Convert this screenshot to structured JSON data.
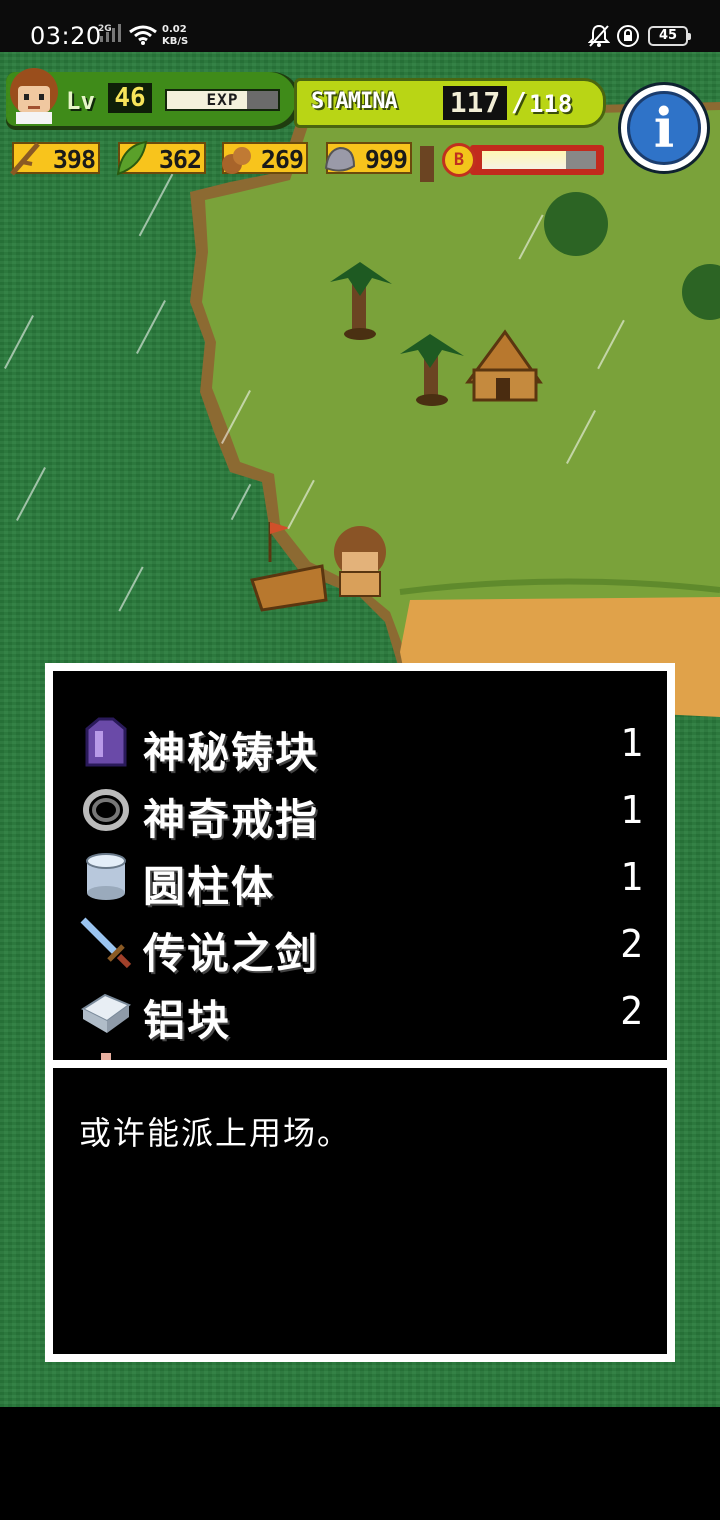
{
  "status_bar": {
    "time": "03:20",
    "network_label": "2G",
    "net_speed_value": "0.02",
    "net_speed_unit": "KB/S",
    "battery": "45"
  },
  "hud": {
    "level_label": "Lv",
    "level": "46",
    "exp_label": "EXP",
    "exp_fraction": 0.72,
    "stamina_label": "STAMINA",
    "stamina_current": "117",
    "stamina_separator": "/",
    "stamina_max": "118",
    "info_icon": "info-icon"
  },
  "resources": [
    {
      "icon": "branch-icon",
      "value": "398"
    },
    {
      "icon": "leaf-icon",
      "value": "362"
    },
    {
      "icon": "nut-icon",
      "value": "269"
    },
    {
      "icon": "stone-icon",
      "value": "999"
    }
  ],
  "bomb": {
    "label": "B",
    "fill_fraction": 0.78
  },
  "inventory": {
    "items": [
      {
        "name": "神秘铸块",
        "qty": "1",
        "icon": "mystery-ingot-icon"
      },
      {
        "name": "神奇戒指",
        "qty": "1",
        "icon": "magic-ring-icon"
      },
      {
        "name": "圆柱体",
        "qty": "1",
        "icon": "cylinder-icon"
      },
      {
        "name": "传说之剑",
        "qty": "2",
        "icon": "legendary-sword-icon"
      },
      {
        "name": "铝块",
        "qty": "2",
        "icon": "aluminum-block-icon"
      }
    ]
  },
  "description": {
    "text": "或许能派上用场。"
  },
  "colors": {
    "sea": "#2a7b3c",
    "grass": "#7aa23a",
    "sand": "#e0a24a",
    "panel_border": "#ffffff",
    "panel_bg": "#000000"
  }
}
